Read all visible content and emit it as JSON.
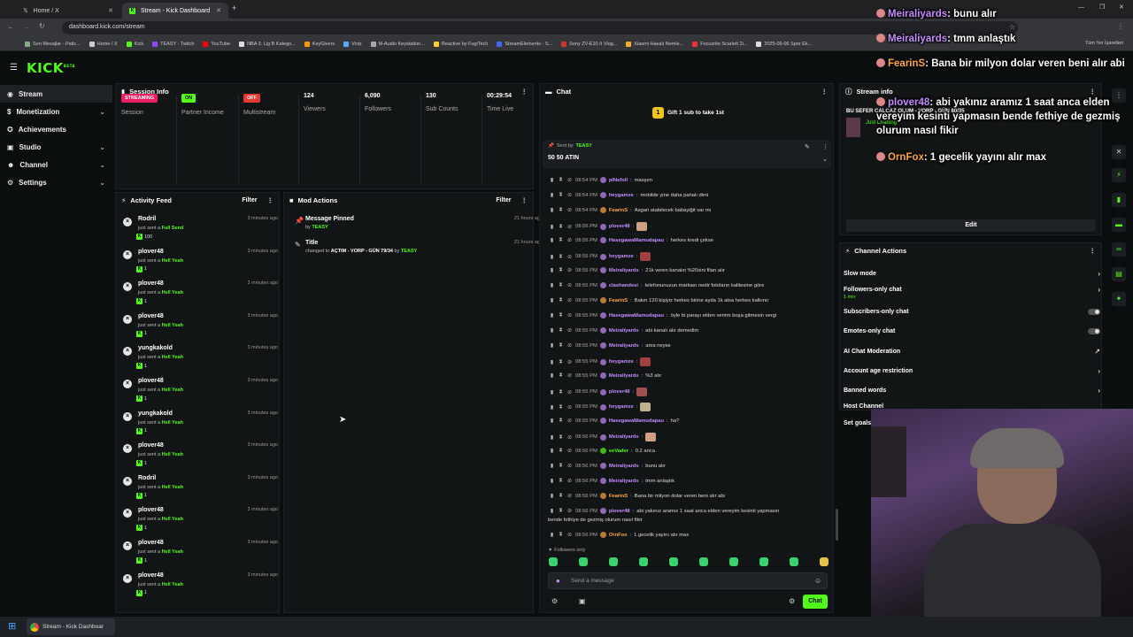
{
  "browser": {
    "tabs": [
      {
        "label": "Home / X"
      },
      {
        "label": "Stream - Kick Dashboard"
      }
    ],
    "url": "dashboard.kick.com/stream",
    "bookmarks": [
      "Son Mesajlar - Patlc...",
      "Home / X",
      "Kick",
      "TEASY - Twitch",
      "YouTube",
      "NBA 3. Lig B Katego...",
      "KeyGivers",
      "Vorp",
      "M-Audio Keystation...",
      "Reactive by FugiTech",
      "StreamElements - S...",
      "Sony ZV-E10 II Vlog...",
      "Xiaomi Havalı Nemle...",
      "Focusrite Scarlett 2i...",
      "2025-09-06 Spor Ek..."
    ],
    "bookmarks_right": "Tüm Yer İşaretleri"
  },
  "app": {
    "logo": "KICK",
    "logo_sup": "BETA"
  },
  "sidebar": {
    "items": [
      {
        "label": "Stream",
        "icon": "stream-icon"
      },
      {
        "label": "Monetization",
        "icon": "dollar-icon"
      },
      {
        "label": "Achievements",
        "icon": "trophy-icon"
      },
      {
        "label": "Studio",
        "icon": "studio-icon"
      },
      {
        "label": "Channel",
        "icon": "user-icon"
      },
      {
        "label": "Settings",
        "icon": "gear-icon"
      }
    ]
  },
  "session": {
    "title": "Session Info",
    "stats": [
      {
        "badge": "STREAMING",
        "label": "Session"
      },
      {
        "badge": "ON",
        "label": "Partner Income"
      },
      {
        "badge": "OFF",
        "label": "Multistream"
      },
      {
        "value": "124",
        "label": "Viewers"
      },
      {
        "value": "6,090",
        "label": "Followers"
      },
      {
        "value": "130",
        "label": "Sub Counts"
      },
      {
        "value": "00:29:54",
        "label": "Time Live"
      }
    ]
  },
  "activity": {
    "title": "Activity Feed",
    "filter": "Filter",
    "items": [
      {
        "name": "Rodril",
        "pre": "just sent a",
        "gift": "Full Send",
        "qty": "100",
        "time": "3 minutes ago"
      },
      {
        "name": "plover48",
        "pre": "just sent a",
        "gift": "Hell Yeah",
        "qty": "1",
        "time": "3 minutes ago"
      },
      {
        "name": "plover48",
        "pre": "just sent a",
        "gift": "Hell Yeah",
        "qty": "1",
        "time": "3 minutes ago"
      },
      {
        "name": "plover48",
        "pre": "just sent a",
        "gift": "Hell Yeah",
        "qty": "1",
        "time": "3 minutes ago"
      },
      {
        "name": "yungkakold",
        "pre": "just sent a",
        "gift": "Hell Yeah",
        "qty": "1",
        "time": "3 minutes ago"
      },
      {
        "name": "plover48",
        "pre": "just sent a",
        "gift": "Hell Yeah",
        "qty": "1",
        "time": "3 minutes ago"
      },
      {
        "name": "yungkakold",
        "pre": "just sent a",
        "gift": "Hell Yeah",
        "qty": "1",
        "time": "3 minutes ago"
      },
      {
        "name": "plover48",
        "pre": "just sent a",
        "gift": "Hell Yeah",
        "qty": "1",
        "time": "3 minutes ago"
      },
      {
        "name": "Rodril",
        "pre": "just sent a",
        "gift": "Hell Yeah",
        "qty": "1",
        "time": "3 minutes ago"
      },
      {
        "name": "plover48",
        "pre": "just sent a",
        "gift": "Hell Yeah",
        "qty": "1",
        "time": "3 minutes ago"
      },
      {
        "name": "plover48",
        "pre": "just sent a",
        "gift": "Hell Yeah",
        "qty": "1",
        "time": "3 minutes ago"
      },
      {
        "name": "plover48",
        "pre": "just sent a",
        "gift": "Hell Yeah",
        "qty": "1",
        "time": "3 minutes ago"
      }
    ]
  },
  "mod": {
    "title": "Mod Actions",
    "filter": "Filter",
    "items": [
      {
        "title": "Message Pinned",
        "sub_pre": "by",
        "sub_user": "TEASY",
        "time": "21 hours ago"
      },
      {
        "title": "Title",
        "sub_pre": "changed to",
        "sub_val": "AÇTIM - VORP - GÜN 79/34",
        "sub_by": "by",
        "sub_user": "TEASY",
        "time": "21 hours ago"
      }
    ]
  },
  "chat": {
    "title": "Chat",
    "goal": "Gift 1 sub to take 1st",
    "pinned_by_label": "Sent by",
    "pinned_user": "TEASY",
    "pinned_text": "50 50 ATIN",
    "followers_only": "Followers only",
    "placeholder": "Send a message",
    "send": "Chat",
    "messages": [
      {
        "time": "08:54 PM",
        "user": "plNefoll",
        "color": "#c58cff",
        "text": "masşım"
      },
      {
        "time": "08:54 PM",
        "user": "heygamze",
        "color": "#c58cff",
        "text": "mobilde yine daha pahalı dimi"
      },
      {
        "time": "08:54 PM",
        "user": "FearinS",
        "color": "#ffa640",
        "text": "Asgari atabilecek babayiğit var mı"
      },
      {
        "time": "08:55 PM",
        "user": "plover48",
        "color": "#c58cff",
        "text": ""
      },
      {
        "time": "08:55 PM",
        "user": "HasegawaMamudapau",
        "color": "#c58cff",
        "text": "herkes kredi çekse"
      },
      {
        "time": "08:55 PM",
        "user": "heygamze",
        "color": "#c58cff",
        "text": ""
      },
      {
        "time": "08:55 PM",
        "user": "Meiraliyards",
        "color": "#c58cff",
        "text": "21k veren kanalın %20sini filan alır"
      },
      {
        "time": "08:55 PM",
        "user": "clashandesi",
        "color": "#c58cff",
        "text": "telefonunuzun markası nedir fotoların kalitesine göre"
      },
      {
        "time": "08:55 PM",
        "user": "FearinS",
        "color": "#ffa640",
        "text": "Bakın 120 kişiyiz herkes birine ayda 1k atsa herkes kalkınır"
      },
      {
        "time": "08:55 PM",
        "user": "HasegawaMamudapau",
        "color": "#c58cff",
        "text": "öyle bi parayı elden verirm boşa gitmesin vergi"
      },
      {
        "time": "08:55 PM",
        "user": "Meiraliyards",
        "color": "#c58cff",
        "text": "abi kanalı alır demedim"
      },
      {
        "time": "08:55 PM",
        "user": "Meiraliyards",
        "color": "#c58cff",
        "text": "ama neyse"
      },
      {
        "time": "08:55 PM",
        "user": "heygamze",
        "color": "#c58cff",
        "text": ""
      },
      {
        "time": "08:55 PM",
        "user": "Meiraliyards",
        "color": "#c58cff",
        "text": "%3 alır"
      },
      {
        "time": "08:55 PM",
        "user": "plover48",
        "color": "#c58cff",
        "text": ""
      },
      {
        "time": "08:55 PM",
        "user": "heygamze",
        "color": "#c58cff",
        "text": ""
      },
      {
        "time": "08:55 PM",
        "user": "HasegawaMamudapau",
        "color": "#c58cff",
        "text": "ha?"
      },
      {
        "time": "08:56 PM",
        "user": "Meiraliyards",
        "color": "#c58cff",
        "text": ""
      },
      {
        "time": "08:56 PM",
        "user": "eeVader",
        "color": "#53fc18",
        "text": "0.2 anca"
      },
      {
        "time": "08:56 PM",
        "user": "Meiraliyards",
        "color": "#c58cff",
        "text": "bunu alır"
      },
      {
        "time": "08:56 PM",
        "user": "Meiraliyards",
        "color": "#c58cff",
        "text": "tmm anlaştık"
      },
      {
        "time": "08:56 PM",
        "user": "FearinS",
        "color": "#ffa640",
        "text": "Bana bir milyon dolar veren beni alır abi"
      },
      {
        "time": "08:56 PM",
        "user": "plover48",
        "color": "#c58cff",
        "text": "abi yakınız aramız 1 saat anca elden vereyim kesinti yapmasın"
      },
      {
        "time": "08:56 PM",
        "user": "OrnFox",
        "color": "#ffa640",
        "text": "1 gecelik yayını alır max"
      }
    ],
    "wrap_line": "bende fethiye de gezmiş olurum nasıl fikir"
  },
  "stream_info": {
    "title": "Stream info",
    "stream_title": "BU SEFER CALCAZ OLUM - VORP - GÜN 80/35",
    "streamer": "Just Chatting",
    "edit": "Edit"
  },
  "channel_actions": {
    "title": "Channel Actions",
    "items": [
      {
        "label": "Slow mode",
        "kind": "arrow"
      },
      {
        "label": "Followers-only chat",
        "kind": "arrow",
        "sub": "1 min"
      },
      {
        "label": "Subscribers-only chat",
        "kind": "toggle"
      },
      {
        "label": "Emotes-only chat",
        "kind": "toggle"
      },
      {
        "label": "AI Chat Moderation",
        "kind": "external"
      },
      {
        "label": "Account age restriction",
        "kind": "arrow"
      },
      {
        "label": "Banned words",
        "kind": "arrow"
      },
      {
        "label": "Host Channel",
        "kind": "none"
      },
      {
        "label": "Set goals",
        "kind": "none"
      }
    ]
  },
  "overlay": [
    {
      "user": "Meiraliyards",
      "text": ": bunu alır",
      "orange": false
    },
    {
      "user": "Meiraliyards",
      "text": ": tmm anlaştık",
      "orange": false
    },
    {
      "user": "FearinS",
      "text": ": Bana bir milyon dolar veren beni alır abi",
      "orange": true
    },
    {
      "user": "plover48",
      "text": ": abi yakınız aramız 1 saat anca elden vereyim kesinti yapmasın bende fethiye de gezmiş olurum nasıl fikir",
      "orange": false
    },
    {
      "user": "OrnFox",
      "text": ": 1 gecelik yayını alır max",
      "orange": true
    }
  ],
  "taskbar": {
    "item": "Stream - Kick Dashboar"
  },
  "colors": {
    "accent": "#53fc18",
    "streaming": "#e91e63",
    "off": "#e53935"
  }
}
